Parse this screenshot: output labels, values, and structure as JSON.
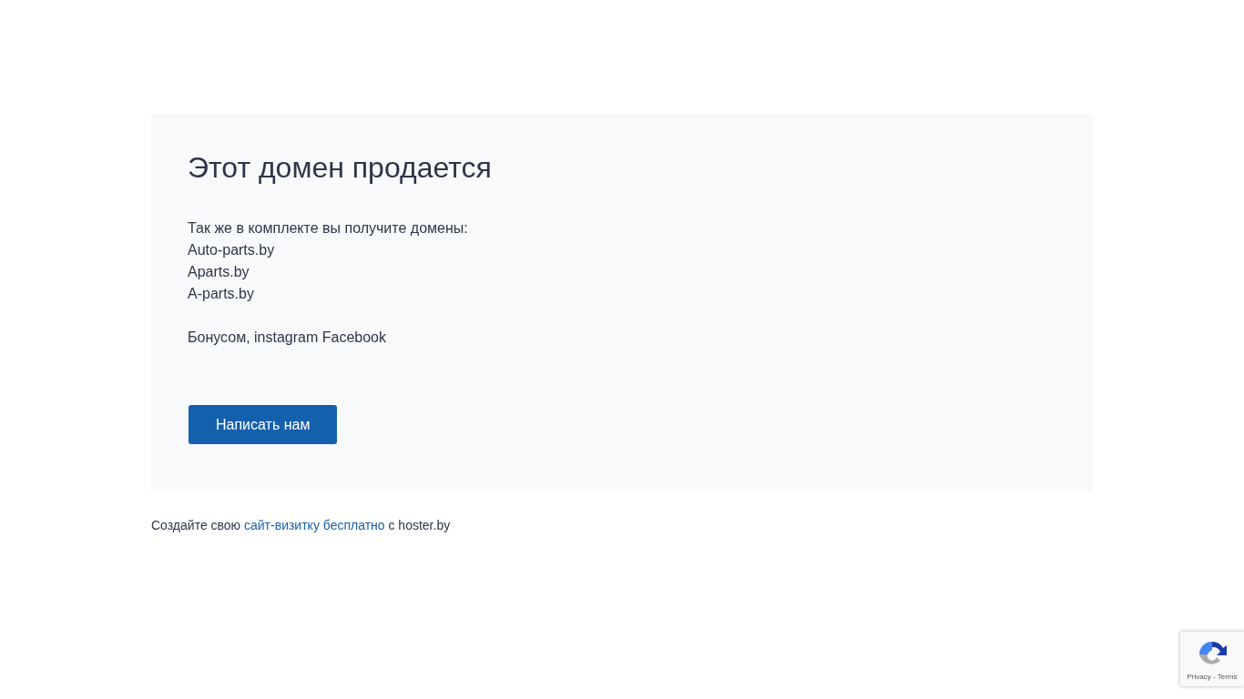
{
  "card": {
    "title": "Этот домен продается",
    "lines": [
      "Так же в комплекте вы получите домены:",
      "Auto-parts.by",
      "Aparts.by",
      "A-parts.by"
    ],
    "bonus": "Бонусом, instagram Facebook",
    "button": "Написать нам"
  },
  "footer": {
    "before": "Создайте свою",
    "link": "сайт-визитку бесплатно",
    "after": "с hoster.by"
  },
  "recaptcha": {
    "links": "Privacy - Terms"
  }
}
